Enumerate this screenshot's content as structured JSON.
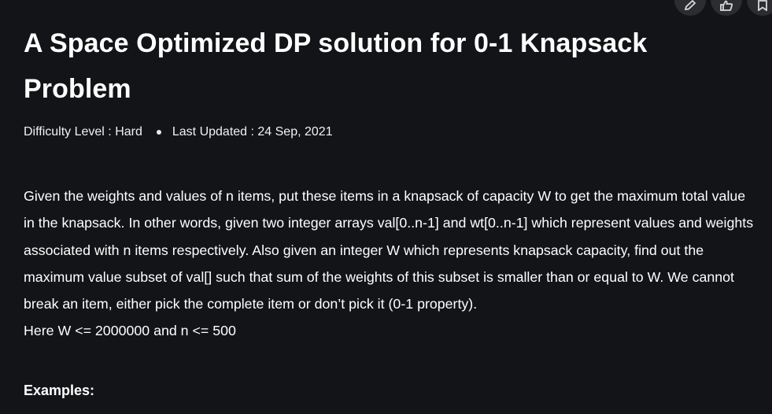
{
  "article": {
    "title": "A Space Optimized DP solution for 0-1 Knapsack Problem",
    "meta": {
      "difficulty": "Difficulty Level : Hard",
      "last_updated": "Last Updated : 24 Sep, 2021"
    },
    "paragraph": "Given the weights and values of n items, put these items in a knapsack of capacity W to get the maximum total value in the knapsack. In other words, given two integer arrays val[0..n-1] and wt[0..n-1] which represent values and weights associated with n items respectively. Also given an integer W which represents knapsack capacity, find out the maximum value subset of val[] such that sum of the weights of this subset is smaller than or equal to W. We cannot break an item, either pick the complete item or don’t pick it (0-1 property).",
    "constraint": "Here W <= 2000000 and n <= 500",
    "examples_heading": "Examples:"
  },
  "toolbar": {
    "icons": [
      "edit-icon",
      "like-icon",
      "bookmark-icon"
    ]
  }
}
